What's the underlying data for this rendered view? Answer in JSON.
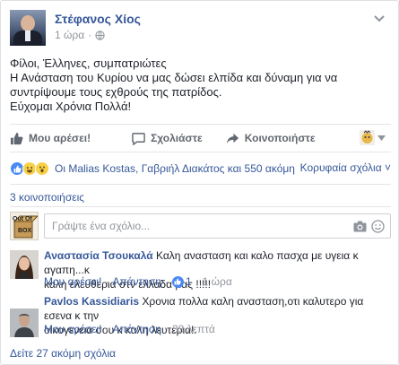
{
  "post": {
    "author": "Στέφανος Χίος",
    "time": "1 ώρα",
    "time_separator": "·",
    "lines": [
      "Φίλοι, Έλληνες, συμπατριώτες",
      "Η Ανάσταση του Κυρίου να μας δώσει ελπίδα και δύναμη για να",
      "συντρίψουμε τους εχθρούς της πατρίδος.",
      "Εύχομαι Χρόνια Πολλά!"
    ]
  },
  "actions": {
    "like_label": "Μου αρέσει!",
    "comment_label": "Σχολιάστε",
    "share_label": "Κοινοποιήστε"
  },
  "reactions": {
    "summary": "Οι Malias Kostas, Γαβριήλ Διακάτος και 550 ακόμη",
    "top_comments_label": "Κορυφαία σχόλια ˅",
    "icons": [
      "like-icon",
      "haha-icon",
      "wow-icon"
    ]
  },
  "shares": {
    "label": "3 κοινοποιήσεις"
  },
  "composer": {
    "placeholder": "Γράψτε ένα σχόλιο...",
    "avatar_text": "Out Of Box"
  },
  "comments": [
    {
      "name": "Αναστασία Τσουκαλά",
      "text": "Καλη ανασταση και καλο πασχα με υγεια κ αγαπη...κ",
      "text_cont": "καλη ελευθερια στν ελλαδα μας !!!!!",
      "like_label": "Μου αρέσει!",
      "reply_label": "Απάντηση",
      "likes": "1",
      "time": "1 ώρα",
      "sep": "·"
    },
    {
      "name": "Pavlos Kassidiaris",
      "text": "Χρονια πολλα καλη ανασταση,οτι καλυτερο για εσενα κ την",
      "text_cont": "οικογενεια σου κ καλη λευτερια!.",
      "like_label": "Μου αρέσει!",
      "reply_label": "Απάντηση",
      "time": "33 λεπτά",
      "sep": "·"
    }
  ],
  "more_comments": "Δείτε 27 ακόμη σχόλια",
  "colors": {
    "link": "#365899",
    "text": "#1d2129",
    "meta": "#90949c",
    "like_blue": "#4a8af4",
    "border": "#dddfe2"
  }
}
